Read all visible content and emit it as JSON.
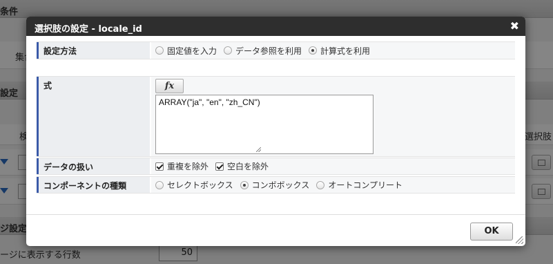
{
  "background": {
    "section_conditions": "条件",
    "aggregate_label": "集合",
    "section_settings": "設定",
    "column_header_partial": "検",
    "column_header_right": "選択肢!",
    "section_page_settings": "ジ設定",
    "rows_per_page_label": "ージに表示する行数",
    "rows_per_page_value": "50"
  },
  "dialog": {
    "title": "選択肢の設定 - locale_id",
    "close_glyph": "✖",
    "setting_method": {
      "label": "設定方法",
      "options": [
        {
          "label": "固定値を入力",
          "selected": false
        },
        {
          "label": "データ参照を利用",
          "selected": false
        },
        {
          "label": "計算式を利用",
          "selected": true
        }
      ]
    },
    "formula": {
      "label": "式",
      "fx_button": "fx",
      "value": "ARRAY(\"ja\", \"en\", \"zh_CN\")"
    },
    "data_handling": {
      "label": "データの扱い",
      "options": [
        {
          "label": "重複を除外",
          "checked": true
        },
        {
          "label": "空白を除外",
          "checked": true
        }
      ]
    },
    "component_type": {
      "label": "コンポーネントの種類",
      "options": [
        {
          "label": "セレクトボックス",
          "selected": false
        },
        {
          "label": "コンボボックス",
          "selected": true
        },
        {
          "label": "オートコンプリート",
          "selected": false
        }
      ]
    },
    "ok_button": "OK"
  },
  "colors": {
    "title_bar": "#2e2e2e",
    "label_accent": "#3a5aa8",
    "label_bg": "#eceef1"
  }
}
